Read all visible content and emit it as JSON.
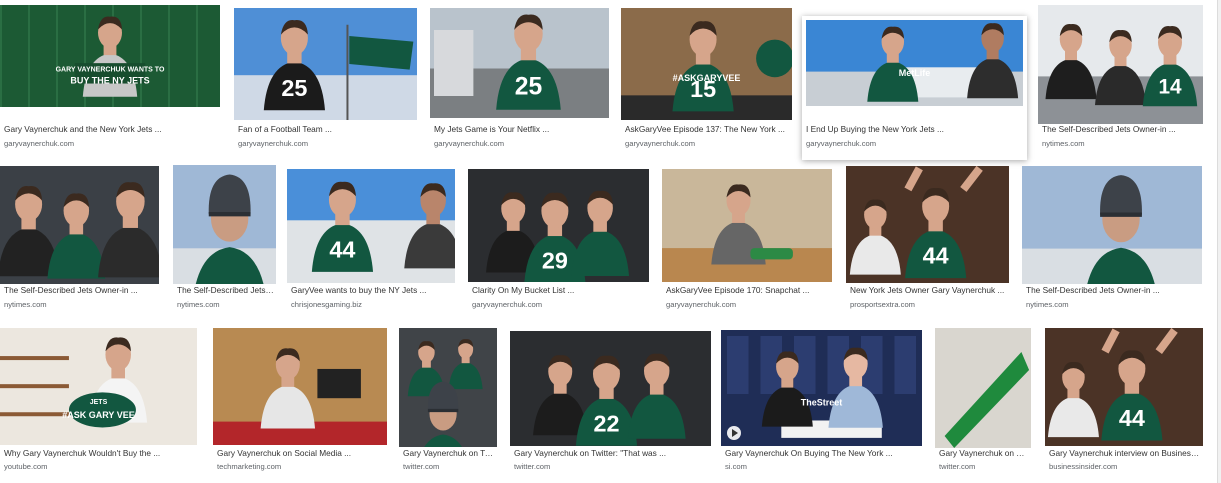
{
  "results": [
    {
      "caption": "Gary Vaynerchuk and the New York Jets ...",
      "source": "garyvaynerchuk.com",
      "scene": "banner",
      "overlay_lines": [
        "GARY VAYNERCHUK WANTS TO",
        "BUY THE NY JETS"
      ]
    },
    {
      "caption": "Fan of a Football Team ...",
      "source": "garyvaynerchuk.com",
      "scene": "flag",
      "jersey": "25"
    },
    {
      "caption": "My Jets Game is Your Netflix ...",
      "source": "garyvaynerchuk.com",
      "scene": "street",
      "jersey": "25"
    },
    {
      "caption": "AskGaryVee Episode 137: The New York ...",
      "source": "garyvaynerchuk.com",
      "scene": "desk",
      "jersey": "15",
      "overlay_lines": [
        "#ASKGARYVEE"
      ]
    },
    {
      "caption": "I End Up Buying the New York Jets ...",
      "source": "garyvaynerchuk.com",
      "scene": "stadium",
      "overlay_lines": [
        "MetLife"
      ],
      "highlighted": true
    },
    {
      "caption": "The Self-Described Jets Owner-in ...",
      "source": "nytimes.com",
      "scene": "group",
      "jersey": "14"
    },
    {
      "caption": "The Self-Described Jets Owner-in ...",
      "source": "nytimes.com",
      "scene": "crowd"
    },
    {
      "caption": "The Self-Described Jets ...",
      "source": "nytimes.com",
      "scene": "beanie"
    },
    {
      "caption": "GaryVee wants to buy the NY Jets ...",
      "source": "chrisjonesgaming.biz",
      "scene": "tailgate",
      "jersey": "44"
    },
    {
      "caption": "Clarity On My Bucket List ...",
      "source": "garyvaynerchuk.com",
      "scene": "party",
      "jersey": "29"
    },
    {
      "caption": "AskGaryVee Episode 170: Snapchat ...",
      "source": "garyvaynerchuk.com",
      "scene": "office"
    },
    {
      "caption": "New York Jets Owner Gary Vaynerchuk ...",
      "source": "prosportsextra.com",
      "scene": "cheer",
      "jersey": "44"
    },
    {
      "caption": "The Self-Described Jets Owner-in ...",
      "source": "nytimes.com",
      "scene": "beanie"
    },
    {
      "caption": "Why Gary Vaynerchuk Wouldn't Buy the ...",
      "source": "youtube.com",
      "scene": "shelf",
      "overlay_lines": [
        "JETS",
        "#ASK GARY VEE"
      ]
    },
    {
      "caption": "Gary Vaynerchuk on Social Media ...",
      "source": "techmarketing.com",
      "scene": "camera"
    },
    {
      "caption": "Gary Vaynerchuk on Tw...",
      "source": "twitter.com",
      "scene": "selfie"
    },
    {
      "caption": "Gary Vaynerchuk on Twitter: \"That was ...",
      "source": "twitter.com",
      "scene": "party",
      "jersey": "22"
    },
    {
      "caption": "Gary Vaynerchuk On Buying The New York ...",
      "source": "si.com",
      "scene": "interview",
      "overlay_lines": [
        "TheStreet"
      ]
    },
    {
      "caption": "Gary Vaynerchuk on Tw...",
      "source": "twitter.com",
      "scene": "closeup"
    },
    {
      "caption": "Gary Vaynerchuk interview on Business ...",
      "source": "businessinsider.com",
      "scene": "cheer",
      "jersey": "44"
    }
  ],
  "colors": {
    "jets_green": "#125740",
    "caption": "#333333",
    "source": "#5f6368"
  }
}
